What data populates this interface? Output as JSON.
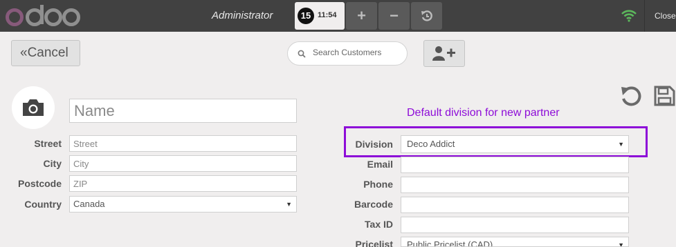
{
  "topbar": {
    "logo_text": "odoo",
    "user": "Administrator",
    "order": {
      "number": "15",
      "time": "11:54"
    },
    "buttons": [
      "+",
      "−"
    ],
    "close_label": "Close"
  },
  "header": {
    "cancel_label": "«Cancel",
    "search_placeholder": "Search Customers"
  },
  "form": {
    "name_placeholder": "Name",
    "left_fields": [
      {
        "label": "Street",
        "placeholder": "Street"
      },
      {
        "label": "City",
        "placeholder": "City"
      },
      {
        "label": "Postcode",
        "placeholder": "ZIP"
      },
      {
        "label": "Country",
        "value": "Canada"
      }
    ],
    "right_fields": [
      {
        "label": "Division",
        "value": "Deco Addict"
      },
      {
        "label": "Email",
        "value": ""
      },
      {
        "label": "Phone",
        "value": ""
      },
      {
        "label": "Barcode",
        "value": ""
      },
      {
        "label": "Tax ID",
        "value": ""
      },
      {
        "label": "Pricelist",
        "value": "Public Pricelist (CAD)"
      }
    ]
  },
  "annotation": "Default division for new partner",
  "colors": {
    "accent": "#8d0bd8",
    "topbar": "#414141",
    "wifi": "#5cb85c"
  }
}
